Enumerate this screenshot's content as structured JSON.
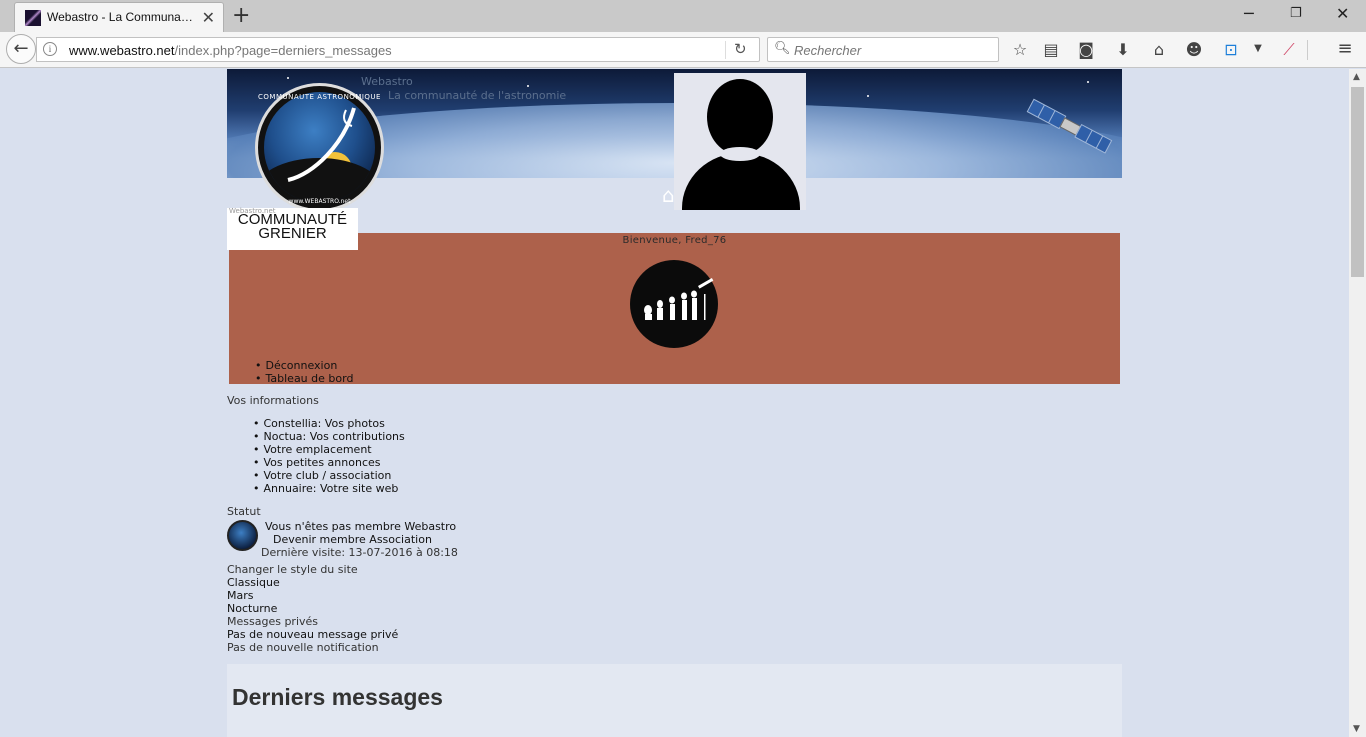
{
  "browser": {
    "tab_title": "Webastro - La Communa…",
    "url_domain": "www.webastro.net",
    "url_path": "/index.php?page=derniers_messages",
    "search_placeholder": "Rechercher"
  },
  "banner": {
    "site_name": "Webastro",
    "tagline": "La communauté de l'astronomie"
  },
  "logo": {
    "text_top": "COMMUNAUTE ASTRONOMIQUE",
    "text_bottom": "www.WEBASTRO.net"
  },
  "community": {
    "small": "Webastro.net",
    "line1": "COMMUNAUTÉ",
    "line2": "GRENIER"
  },
  "panel": {
    "welcome": "Bienvenue, Fred_76",
    "links": [
      "Déconnexion",
      "Tableau de bord"
    ]
  },
  "info": {
    "title": "Vos informations",
    "items": [
      "Constellia: Vos photos",
      "Noctua: Vos contributions",
      "Votre emplacement",
      "Vos petites annonces",
      "Votre club / association",
      "Annuaire: Votre site web"
    ]
  },
  "status": {
    "title": "Statut",
    "not_member": "Vous n'êtes pas membre Webastro",
    "become_member": "Devenir membre Association",
    "last_visit": "Dernière visite: 13-07-2016 à 08:18"
  },
  "style": {
    "title": "Changer le style du site",
    "options": [
      "Classique",
      "Mars",
      "Nocturne"
    ]
  },
  "messages": {
    "title": "Messages privés",
    "none": "Pas de nouveau message privé",
    "notifications": "Pas de nouvelle notification"
  },
  "latest": {
    "heading": "Derniers messages"
  },
  "colors": {
    "page_bg": "#d9e0ee",
    "panel_bg": "#ad614b",
    "latest_bg": "#e3e8f2"
  }
}
